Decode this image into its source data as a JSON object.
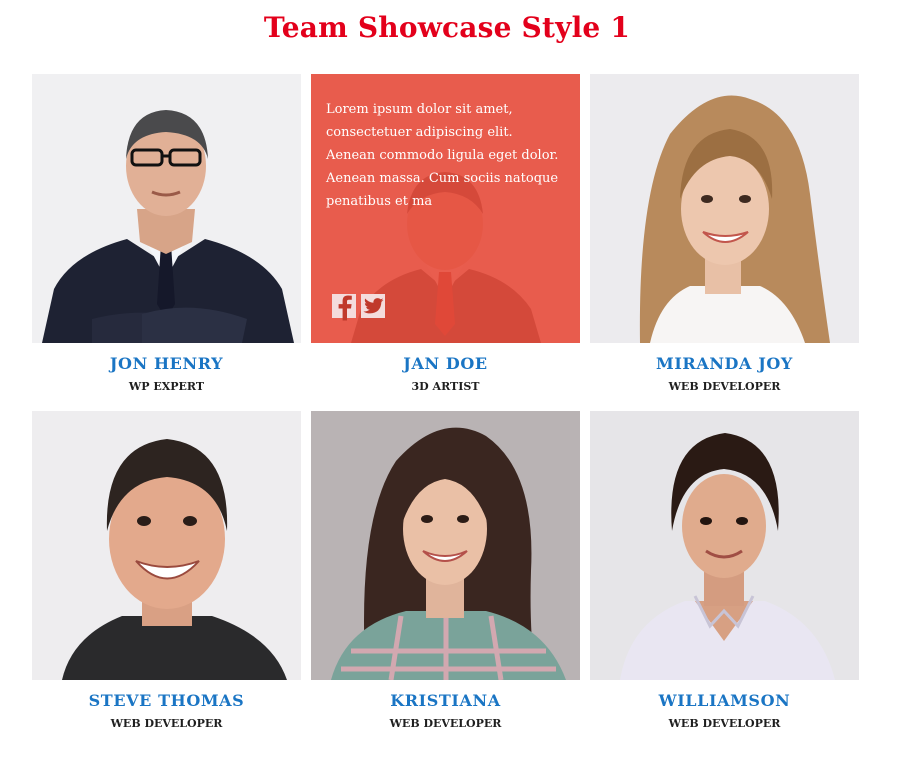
{
  "page": {
    "title": "Team Showcase Style 1"
  },
  "colors": {
    "title": "#e3001b",
    "name": "#1a75c4",
    "role": "#1f1f1f",
    "overlay": "#e74c3c"
  },
  "members": [
    {
      "name": "JON HENRY",
      "role": "WP EXPERT",
      "photo": "man-in-suit-with-glasses"
    },
    {
      "name": "JAN DOE",
      "role": "3D ARTIST",
      "photo": "man-in-suit-hover",
      "hover_text": "Lorem ipsum dolor sit amet, consectetuer adipiscing elit. Aenean commodo ligula eget dolor. Aenean massa. Cum sociis natoque penatibus et ma",
      "socials": [
        "facebook-icon",
        "twitter-icon"
      ]
    },
    {
      "name": "MIRANDA JOY",
      "role": "WEB DEVELOPER",
      "photo": "smiling-woman-blonde"
    },
    {
      "name": "STEVE THOMAS",
      "role": "WEB DEVELOPER",
      "photo": "smiling-man-dark-tshirt"
    },
    {
      "name": "KRISTIANA",
      "role": "WEB DEVELOPER",
      "photo": "smiling-woman-plaid-shirt"
    },
    {
      "name": "WILLIAMSON",
      "role": "WEB DEVELOPER",
      "photo": "young-man-white-shirt"
    }
  ]
}
